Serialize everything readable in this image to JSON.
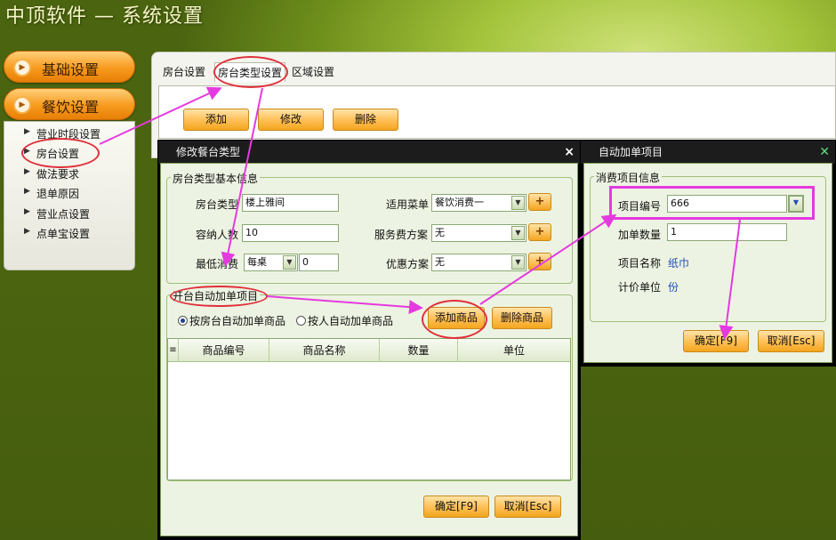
{
  "app": {
    "title": "中顶软件 — 系统设置"
  },
  "sidebar": {
    "sections": [
      {
        "label": "基础设置"
      },
      {
        "label": "餐饮设置"
      }
    ],
    "items": [
      {
        "label": "营业时段设置"
      },
      {
        "label": "房台设置"
      },
      {
        "label": "做法要求"
      },
      {
        "label": "退单原因"
      },
      {
        "label": "营业点设置"
      },
      {
        "label": "点单宝设置"
      }
    ]
  },
  "main": {
    "tabs": [
      {
        "label": "房台设置"
      },
      {
        "label": "房台类型设置"
      },
      {
        "label": "区域设置"
      }
    ],
    "toolbar": {
      "add": "添加",
      "edit": "修改",
      "delete": "删除"
    }
  },
  "edit_dialog": {
    "title": "修改餐台类型",
    "close": "×",
    "basic_group": "房台类型基本信息",
    "fields": {
      "room_type_label": "房台类型",
      "room_type_value": "楼上雅间",
      "capacity_label": "容纳人数",
      "capacity_value": "10",
      "min_spend_label": "最低消费",
      "min_spend_mode": "每桌",
      "min_spend_value": "0",
      "menu_label": "适用菜单",
      "menu_value": "餐饮消费一",
      "service_label": "服务费方案",
      "service_value": "无",
      "discount_label": "优惠方案",
      "discount_value": "无",
      "plus": "+"
    },
    "auto_group": "开台自动加单项目",
    "radio_by_room": "按房台自动加单商品",
    "radio_by_person": "按人自动加单商品",
    "add_goods": "添加商品",
    "delete_goods": "删除商品",
    "grid_headers": [
      "商品编号",
      "商品名称",
      "数量",
      "单位"
    ],
    "grid_corner": "≡",
    "ok": "确定[F9]",
    "cancel": "取消[Esc]"
  },
  "auto_dialog": {
    "title": "自动加单项目",
    "close": "✕",
    "group": "消费项目信息",
    "code_label": "项目编号",
    "code_value": "666",
    "qty_label": "加单数量",
    "qty_value": "1",
    "name_label": "项目名称",
    "name_value": "纸巾",
    "unit_label": "计价单位",
    "unit_value": "份",
    "ok": "确定[F9]",
    "cancel": "取消[Esc]"
  },
  "colors": {
    "accent": "#f79a1d",
    "annotation_red": "#e0303a",
    "annotation_magenta": "#e53adf",
    "dialog_title": "#1c1c1c"
  }
}
